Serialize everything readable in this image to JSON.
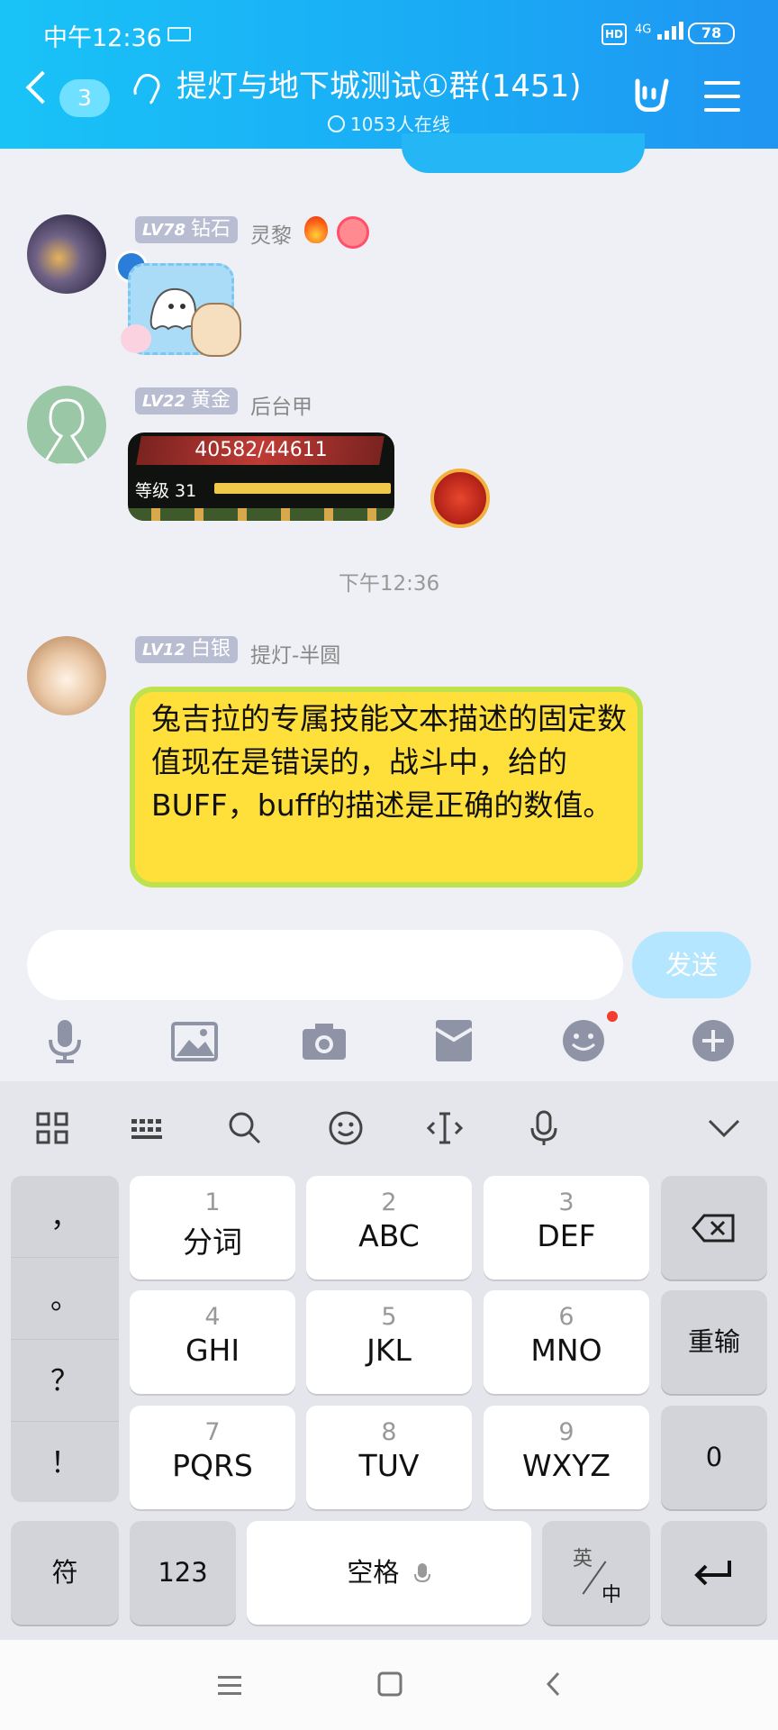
{
  "status_bar": {
    "time": "中午12:36",
    "hd": "HD",
    "network": "4G",
    "battery": "78"
  },
  "header": {
    "unread_count": "3",
    "group_title": "提灯与地下城测试①群(1451)",
    "online": "1053人在线"
  },
  "messages": [
    {
      "level": "LV78",
      "rank": "钻石",
      "nickname": "灵黎"
    },
    {
      "level": "LV22",
      "rank": "黄金",
      "nickname": "后台甲",
      "game_card": {
        "hp": "40582/44611",
        "level_label": "等级 31"
      }
    },
    {
      "level": "LV12",
      "rank": "白银",
      "nickname": "提灯-半圆",
      "text": "兔吉拉的专属技能文本描述的固定数值现在是错误的，战斗中，给的BUFF，buff的描述是正确的数值。"
    }
  ],
  "time_separator": "下午12:36",
  "composer": {
    "send_label": "发送"
  },
  "toolbar_icons": [
    "mic-icon",
    "image-icon",
    "camera-icon",
    "redpacket-icon",
    "emoji-icon",
    "plus-icon"
  ],
  "keyboard": {
    "punctuation": [
      "，",
      "。",
      "？",
      "！"
    ],
    "keys": [
      {
        "num": "1",
        "letters": "分词"
      },
      {
        "num": "2",
        "letters": "ABC"
      },
      {
        "num": "3",
        "letters": "DEF"
      },
      {
        "num": "4",
        "letters": "GHI"
      },
      {
        "num": "5",
        "letters": "JKL"
      },
      {
        "num": "6",
        "letters": "MNO"
      },
      {
        "num": "7",
        "letters": "PQRS"
      },
      {
        "num": "8",
        "letters": "TUV"
      },
      {
        "num": "9",
        "letters": "WXYZ"
      }
    ],
    "reenter": "重输",
    "zero": "0",
    "symbols": "符",
    "numbers": "123",
    "space": "空格",
    "lang_top": "英",
    "lang_bottom": "中"
  }
}
